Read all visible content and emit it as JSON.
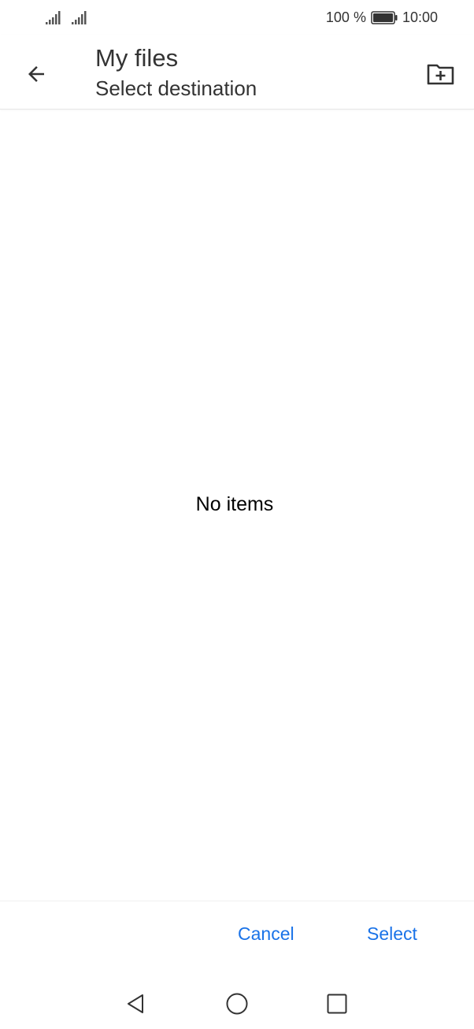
{
  "status_bar": {
    "battery_percent": "100 %",
    "time": "10:00",
    "signal_icons": [
      "signal-icon",
      "signal-icon"
    ],
    "battery_icon": "battery-icon"
  },
  "app_bar": {
    "title": "My files",
    "subtitle": "Select destination",
    "back_icon": "arrow-back-icon",
    "new_folder_icon": "new-folder-icon"
  },
  "content": {
    "empty_message": "No items"
  },
  "actions": {
    "cancel_label": "Cancel",
    "select_label": "Select",
    "accent_color": "#1a73e8"
  },
  "nav_bar": {
    "icons": [
      "triangle-back-icon",
      "circle-home-icon",
      "square-recents-icon"
    ]
  }
}
